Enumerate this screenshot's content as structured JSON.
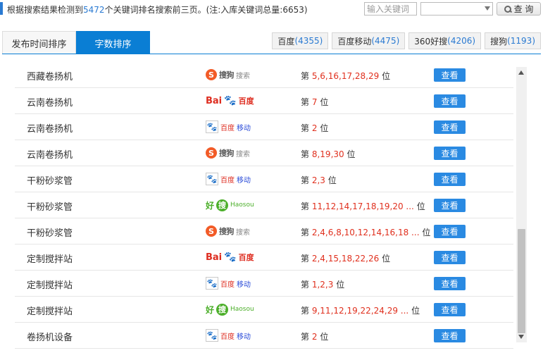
{
  "summary": {
    "prefix": "根据搜索结果检测到",
    "count": "5472",
    "suffix": "个关键词排名搜索前三页。(注:入库关键词总量:6653)"
  },
  "search": {
    "placeholder": "输入关键词",
    "button_label": "查 询"
  },
  "tabs": [
    {
      "label": "发布时间排序",
      "active": false
    },
    {
      "label": "字数排序",
      "active": true
    }
  ],
  "engines": [
    {
      "name": "百度",
      "count": "(4355)"
    },
    {
      "name": "百度移动",
      "count": "(4475)"
    },
    {
      "name": "360好搜",
      "count": "(4206)"
    },
    {
      "name": "搜狗",
      "count": "(1193)"
    }
  ],
  "logos": {
    "sogou": {
      "badge": "S",
      "text": "搜狗",
      "text2": "搜索"
    },
    "baidu": {
      "bai": "Bai",
      "paw": "🐾",
      "du": "百度"
    },
    "baidu_mobile": {
      "paw": "🐾",
      "text": "百度",
      "text2": "移动"
    },
    "haosou": {
      "hao": "好",
      "sou": "搜",
      "en": "Haosou"
    }
  },
  "rank_prefix": "第",
  "rank_suffix": "位",
  "view_label": "查看",
  "rows": [
    {
      "keyword": "西藏卷扬机",
      "engine": "sogou",
      "positions": "5,6,16,17,28,29"
    },
    {
      "keyword": "云南卷扬机",
      "engine": "baidu",
      "positions": "7"
    },
    {
      "keyword": "云南卷扬机",
      "engine": "baidu_mobile",
      "positions": "2"
    },
    {
      "keyword": "云南卷扬机",
      "engine": "sogou",
      "positions": "8,19,30"
    },
    {
      "keyword": "干粉砂浆管",
      "engine": "baidu_mobile",
      "positions": "2,3"
    },
    {
      "keyword": "干粉砂浆管",
      "engine": "haosou",
      "positions": "11,12,14,17,18,19,20 ..."
    },
    {
      "keyword": "干粉砂浆管",
      "engine": "sogou",
      "positions": "2,4,6,8,10,12,14,16,18 ..."
    },
    {
      "keyword": "定制搅拌站",
      "engine": "baidu",
      "positions": "2,4,15,18,22,26"
    },
    {
      "keyword": "定制搅拌站",
      "engine": "baidu_mobile",
      "positions": "1,2,3"
    },
    {
      "keyword": "定制搅拌站",
      "engine": "haosou",
      "positions": "9,11,12,19,22,24,29 ..."
    },
    {
      "keyword": "卷扬机设备",
      "engine": "baidu_mobile",
      "positions": "2"
    }
  ]
}
